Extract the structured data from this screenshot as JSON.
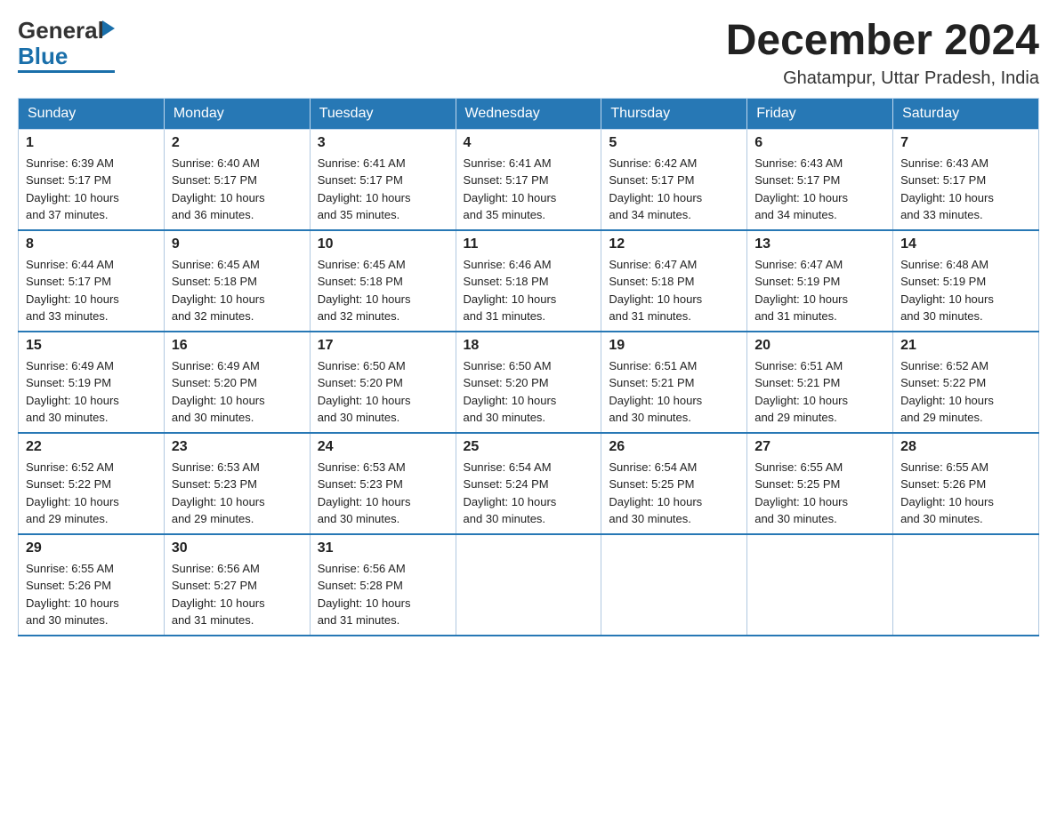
{
  "header": {
    "logo_general": "General",
    "logo_blue": "Blue",
    "month_title": "December 2024",
    "location": "Ghatampur, Uttar Pradesh, India"
  },
  "days_of_week": [
    "Sunday",
    "Monday",
    "Tuesday",
    "Wednesday",
    "Thursday",
    "Friday",
    "Saturday"
  ],
  "weeks": [
    [
      {
        "day": "1",
        "sunrise": "6:39 AM",
        "sunset": "5:17 PM",
        "daylight": "10 hours and 37 minutes."
      },
      {
        "day": "2",
        "sunrise": "6:40 AM",
        "sunset": "5:17 PM",
        "daylight": "10 hours and 36 minutes."
      },
      {
        "day": "3",
        "sunrise": "6:41 AM",
        "sunset": "5:17 PM",
        "daylight": "10 hours and 35 minutes."
      },
      {
        "day": "4",
        "sunrise": "6:41 AM",
        "sunset": "5:17 PM",
        "daylight": "10 hours and 35 minutes."
      },
      {
        "day": "5",
        "sunrise": "6:42 AM",
        "sunset": "5:17 PM",
        "daylight": "10 hours and 34 minutes."
      },
      {
        "day": "6",
        "sunrise": "6:43 AM",
        "sunset": "5:17 PM",
        "daylight": "10 hours and 34 minutes."
      },
      {
        "day": "7",
        "sunrise": "6:43 AM",
        "sunset": "5:17 PM",
        "daylight": "10 hours and 33 minutes."
      }
    ],
    [
      {
        "day": "8",
        "sunrise": "6:44 AM",
        "sunset": "5:17 PM",
        "daylight": "10 hours and 33 minutes."
      },
      {
        "day": "9",
        "sunrise": "6:45 AM",
        "sunset": "5:18 PM",
        "daylight": "10 hours and 32 minutes."
      },
      {
        "day": "10",
        "sunrise": "6:45 AM",
        "sunset": "5:18 PM",
        "daylight": "10 hours and 32 minutes."
      },
      {
        "day": "11",
        "sunrise": "6:46 AM",
        "sunset": "5:18 PM",
        "daylight": "10 hours and 31 minutes."
      },
      {
        "day": "12",
        "sunrise": "6:47 AM",
        "sunset": "5:18 PM",
        "daylight": "10 hours and 31 minutes."
      },
      {
        "day": "13",
        "sunrise": "6:47 AM",
        "sunset": "5:19 PM",
        "daylight": "10 hours and 31 minutes."
      },
      {
        "day": "14",
        "sunrise": "6:48 AM",
        "sunset": "5:19 PM",
        "daylight": "10 hours and 30 minutes."
      }
    ],
    [
      {
        "day": "15",
        "sunrise": "6:49 AM",
        "sunset": "5:19 PM",
        "daylight": "10 hours and 30 minutes."
      },
      {
        "day": "16",
        "sunrise": "6:49 AM",
        "sunset": "5:20 PM",
        "daylight": "10 hours and 30 minutes."
      },
      {
        "day": "17",
        "sunrise": "6:50 AM",
        "sunset": "5:20 PM",
        "daylight": "10 hours and 30 minutes."
      },
      {
        "day": "18",
        "sunrise": "6:50 AM",
        "sunset": "5:20 PM",
        "daylight": "10 hours and 30 minutes."
      },
      {
        "day": "19",
        "sunrise": "6:51 AM",
        "sunset": "5:21 PM",
        "daylight": "10 hours and 30 minutes."
      },
      {
        "day": "20",
        "sunrise": "6:51 AM",
        "sunset": "5:21 PM",
        "daylight": "10 hours and 29 minutes."
      },
      {
        "day": "21",
        "sunrise": "6:52 AM",
        "sunset": "5:22 PM",
        "daylight": "10 hours and 29 minutes."
      }
    ],
    [
      {
        "day": "22",
        "sunrise": "6:52 AM",
        "sunset": "5:22 PM",
        "daylight": "10 hours and 29 minutes."
      },
      {
        "day": "23",
        "sunrise": "6:53 AM",
        "sunset": "5:23 PM",
        "daylight": "10 hours and 29 minutes."
      },
      {
        "day": "24",
        "sunrise": "6:53 AM",
        "sunset": "5:23 PM",
        "daylight": "10 hours and 30 minutes."
      },
      {
        "day": "25",
        "sunrise": "6:54 AM",
        "sunset": "5:24 PM",
        "daylight": "10 hours and 30 minutes."
      },
      {
        "day": "26",
        "sunrise": "6:54 AM",
        "sunset": "5:25 PM",
        "daylight": "10 hours and 30 minutes."
      },
      {
        "day": "27",
        "sunrise": "6:55 AM",
        "sunset": "5:25 PM",
        "daylight": "10 hours and 30 minutes."
      },
      {
        "day": "28",
        "sunrise": "6:55 AM",
        "sunset": "5:26 PM",
        "daylight": "10 hours and 30 minutes."
      }
    ],
    [
      {
        "day": "29",
        "sunrise": "6:55 AM",
        "sunset": "5:26 PM",
        "daylight": "10 hours and 30 minutes."
      },
      {
        "day": "30",
        "sunrise": "6:56 AM",
        "sunset": "5:27 PM",
        "daylight": "10 hours and 31 minutes."
      },
      {
        "day": "31",
        "sunrise": "6:56 AM",
        "sunset": "5:28 PM",
        "daylight": "10 hours and 31 minutes."
      },
      null,
      null,
      null,
      null
    ]
  ],
  "labels": {
    "sunrise": "Sunrise:",
    "sunset": "Sunset:",
    "daylight": "Daylight:"
  }
}
